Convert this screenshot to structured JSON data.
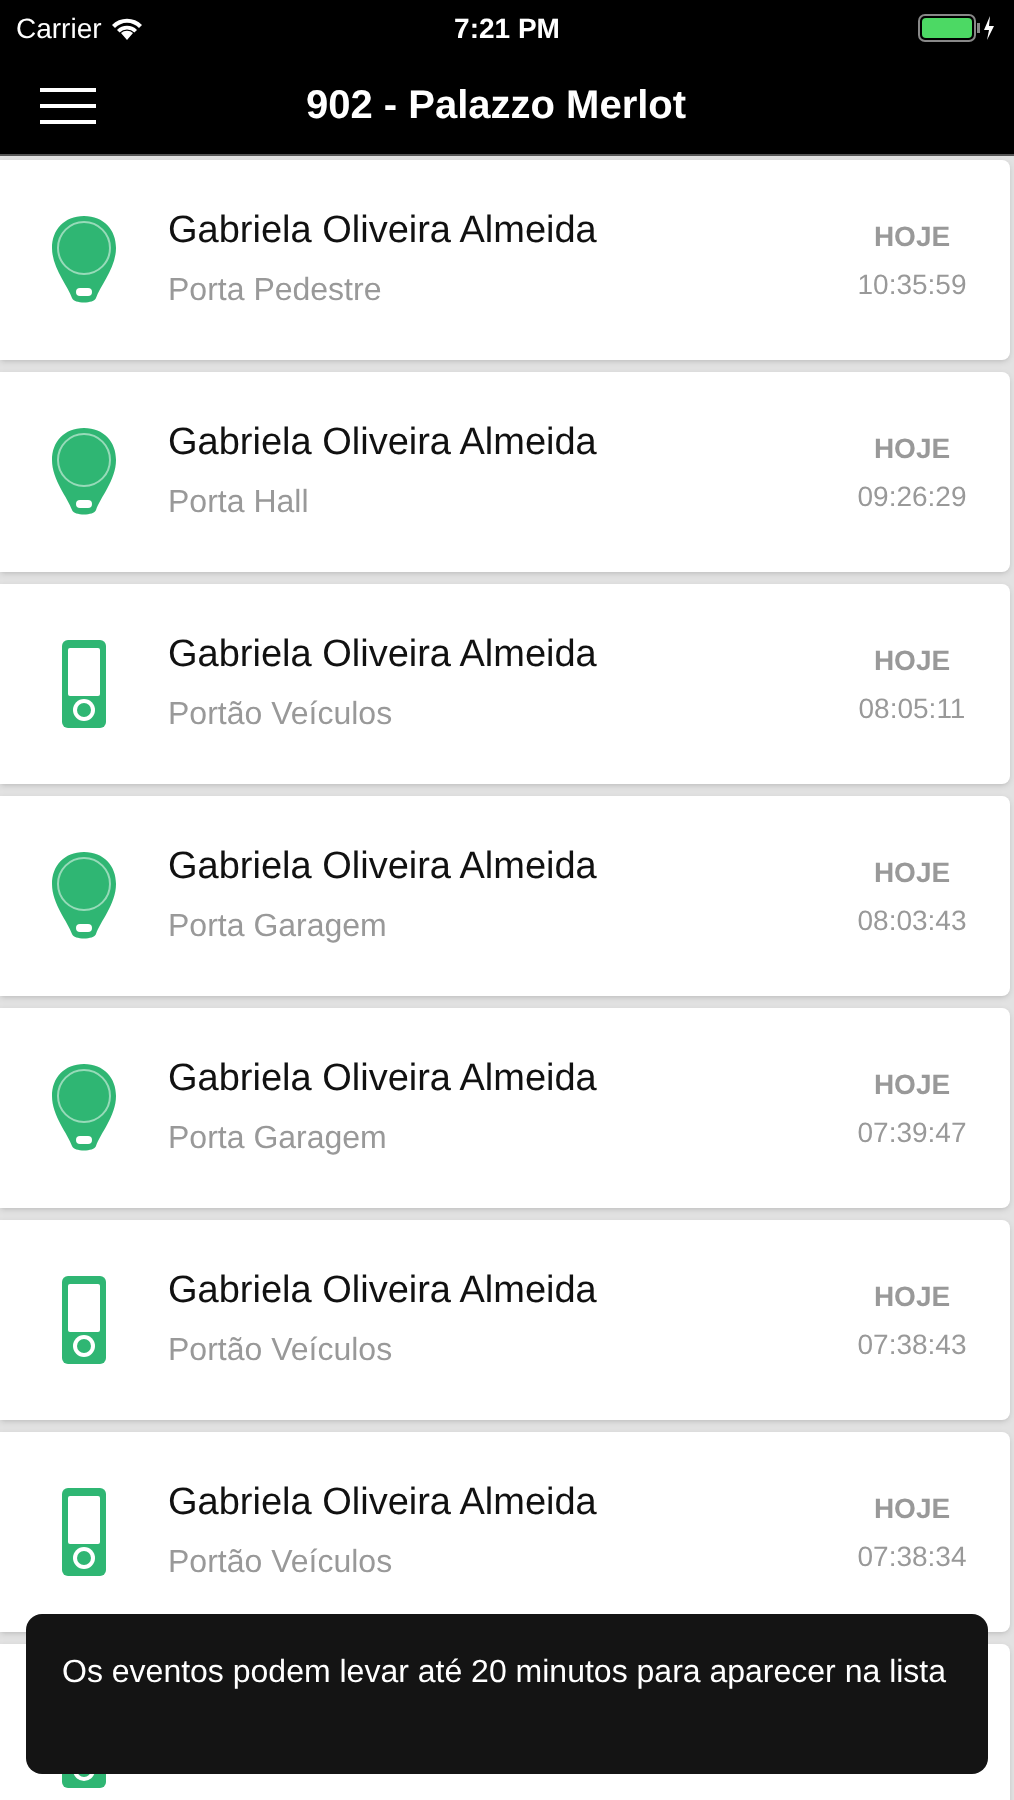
{
  "status_bar": {
    "carrier": "Carrier",
    "time": "7:21 PM"
  },
  "nav": {
    "title": "902 - Palazzo Merlot"
  },
  "events": [
    {
      "kind": "tag",
      "name": "Gabriela Oliveira Almeida",
      "place": "Porta Pedestre",
      "day": "HOJE",
      "time": "10:35:59"
    },
    {
      "kind": "tag",
      "name": "Gabriela Oliveira Almeida",
      "place": "Porta Hall",
      "day": "HOJE",
      "time": "09:26:29"
    },
    {
      "kind": "remote",
      "name": "Gabriela Oliveira Almeida",
      "place": "Portão Veículos",
      "day": "HOJE",
      "time": "08:05:11"
    },
    {
      "kind": "tag",
      "name": "Gabriela Oliveira Almeida",
      "place": "Porta Garagem",
      "day": "HOJE",
      "time": "08:03:43"
    },
    {
      "kind": "tag",
      "name": "Gabriela Oliveira Almeida",
      "place": "Porta Garagem",
      "day": "HOJE",
      "time": "07:39:47"
    },
    {
      "kind": "remote",
      "name": "Gabriela Oliveira Almeida",
      "place": "Portão Veículos",
      "day": "HOJE",
      "time": "07:38:43"
    },
    {
      "kind": "remote",
      "name": "Gabriela Oliveira Almeida",
      "place": "Portão Veículos",
      "day": "HOJE",
      "time": "07:38:34"
    },
    {
      "kind": "remote"
    }
  ],
  "toast": {
    "message": "Os eventos podem levar até 20 minutos para aparecer na lista"
  }
}
